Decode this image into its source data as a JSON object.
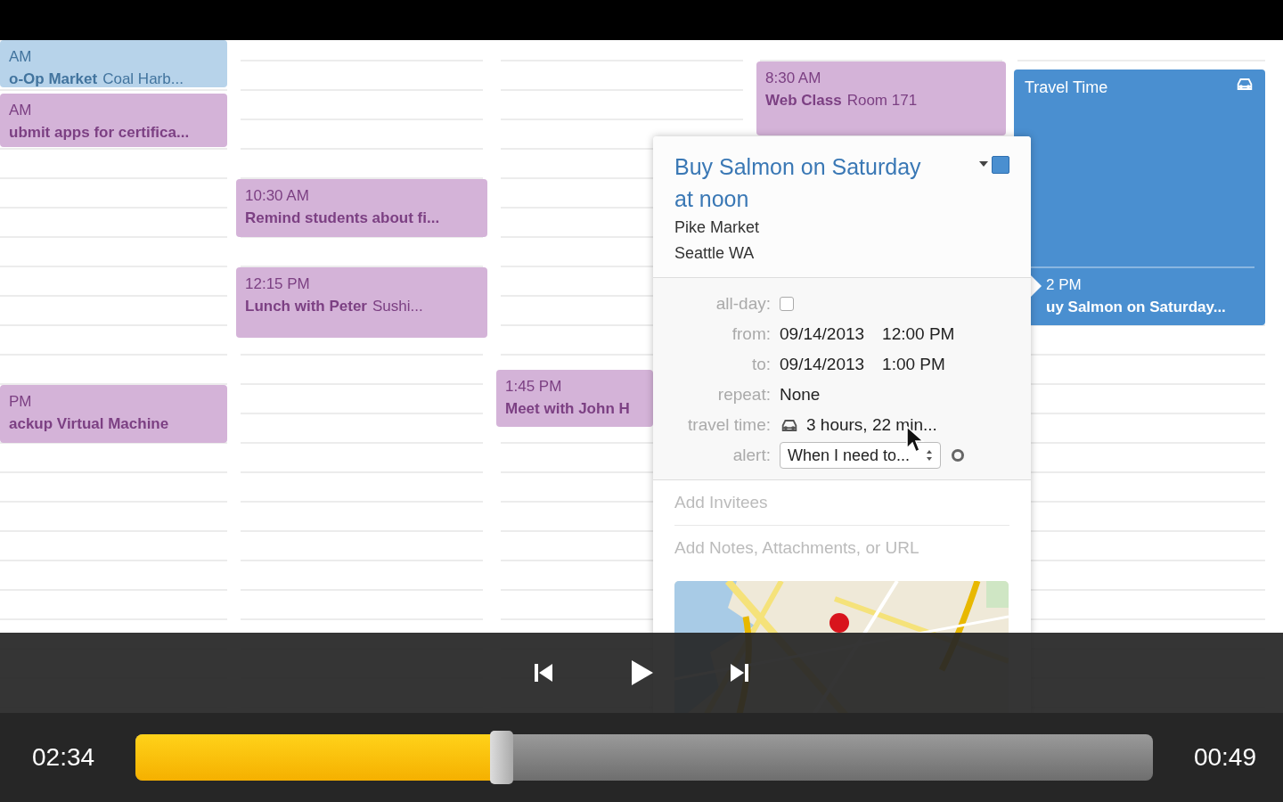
{
  "calendar": {
    "events": [
      {
        "kind": "event",
        "time": "AM",
        "title": "o-Op Market",
        "location": "Coal Harb...",
        "color": "#b7d3ea"
      },
      {
        "kind": "event",
        "time": "AM",
        "title": "ubmit apps for certifica...",
        "color": "#d4b3d8"
      },
      {
        "kind": "event",
        "time": "PM",
        "title": "ackup Virtual Machine",
        "color": "#d4b3d8"
      },
      {
        "kind": "event",
        "time": "10:30 AM",
        "title": "Remind students about fi...",
        "color": "#d4b3d8"
      },
      {
        "kind": "event",
        "time": "12:15 PM",
        "title": "Lunch with Peter",
        "location": "Sushi...",
        "color": "#d4b3d8"
      },
      {
        "kind": "event",
        "time": "1:45 PM",
        "title": "Meet with John H",
        "color": "#d4b3d8"
      },
      {
        "kind": "event",
        "time": "8:30 AM",
        "title": "Web Class",
        "location": "Room 171",
        "color": "#d4b3d8"
      },
      {
        "kind": "travel",
        "title": "Travel Time",
        "time": "2 PM",
        "event_title": "uy Salmon on Saturday...",
        "color": "#4a8fd0"
      }
    ]
  },
  "popover": {
    "title": "Buy Salmon on Saturday at noon",
    "location_lines": [
      "Pike Market",
      "Seattle WA"
    ],
    "fields": [
      {
        "kind": "checkbox",
        "label": "all-day:",
        "checked": false
      },
      {
        "kind": "datetime",
        "label": "from:",
        "date": "09/14/2013",
        "time": "12:00 PM"
      },
      {
        "kind": "datetime",
        "label": "to:",
        "date": "09/14/2013",
        "time": "1:00 PM"
      },
      {
        "kind": "text",
        "label": "repeat:",
        "value": "None"
      },
      {
        "kind": "travel",
        "label": "travel time:",
        "value": "3 hours, 22 min..."
      },
      {
        "kind": "select",
        "label": "alert:",
        "value": "When I need to..."
      }
    ],
    "invitees_placeholder": "Add Invitees",
    "notes_placeholder": "Add Notes, Attachments, or URL"
  },
  "player": {
    "elapsed": "02:34",
    "remaining": "00:49",
    "progress": {
      "level": 0.36
    }
  }
}
